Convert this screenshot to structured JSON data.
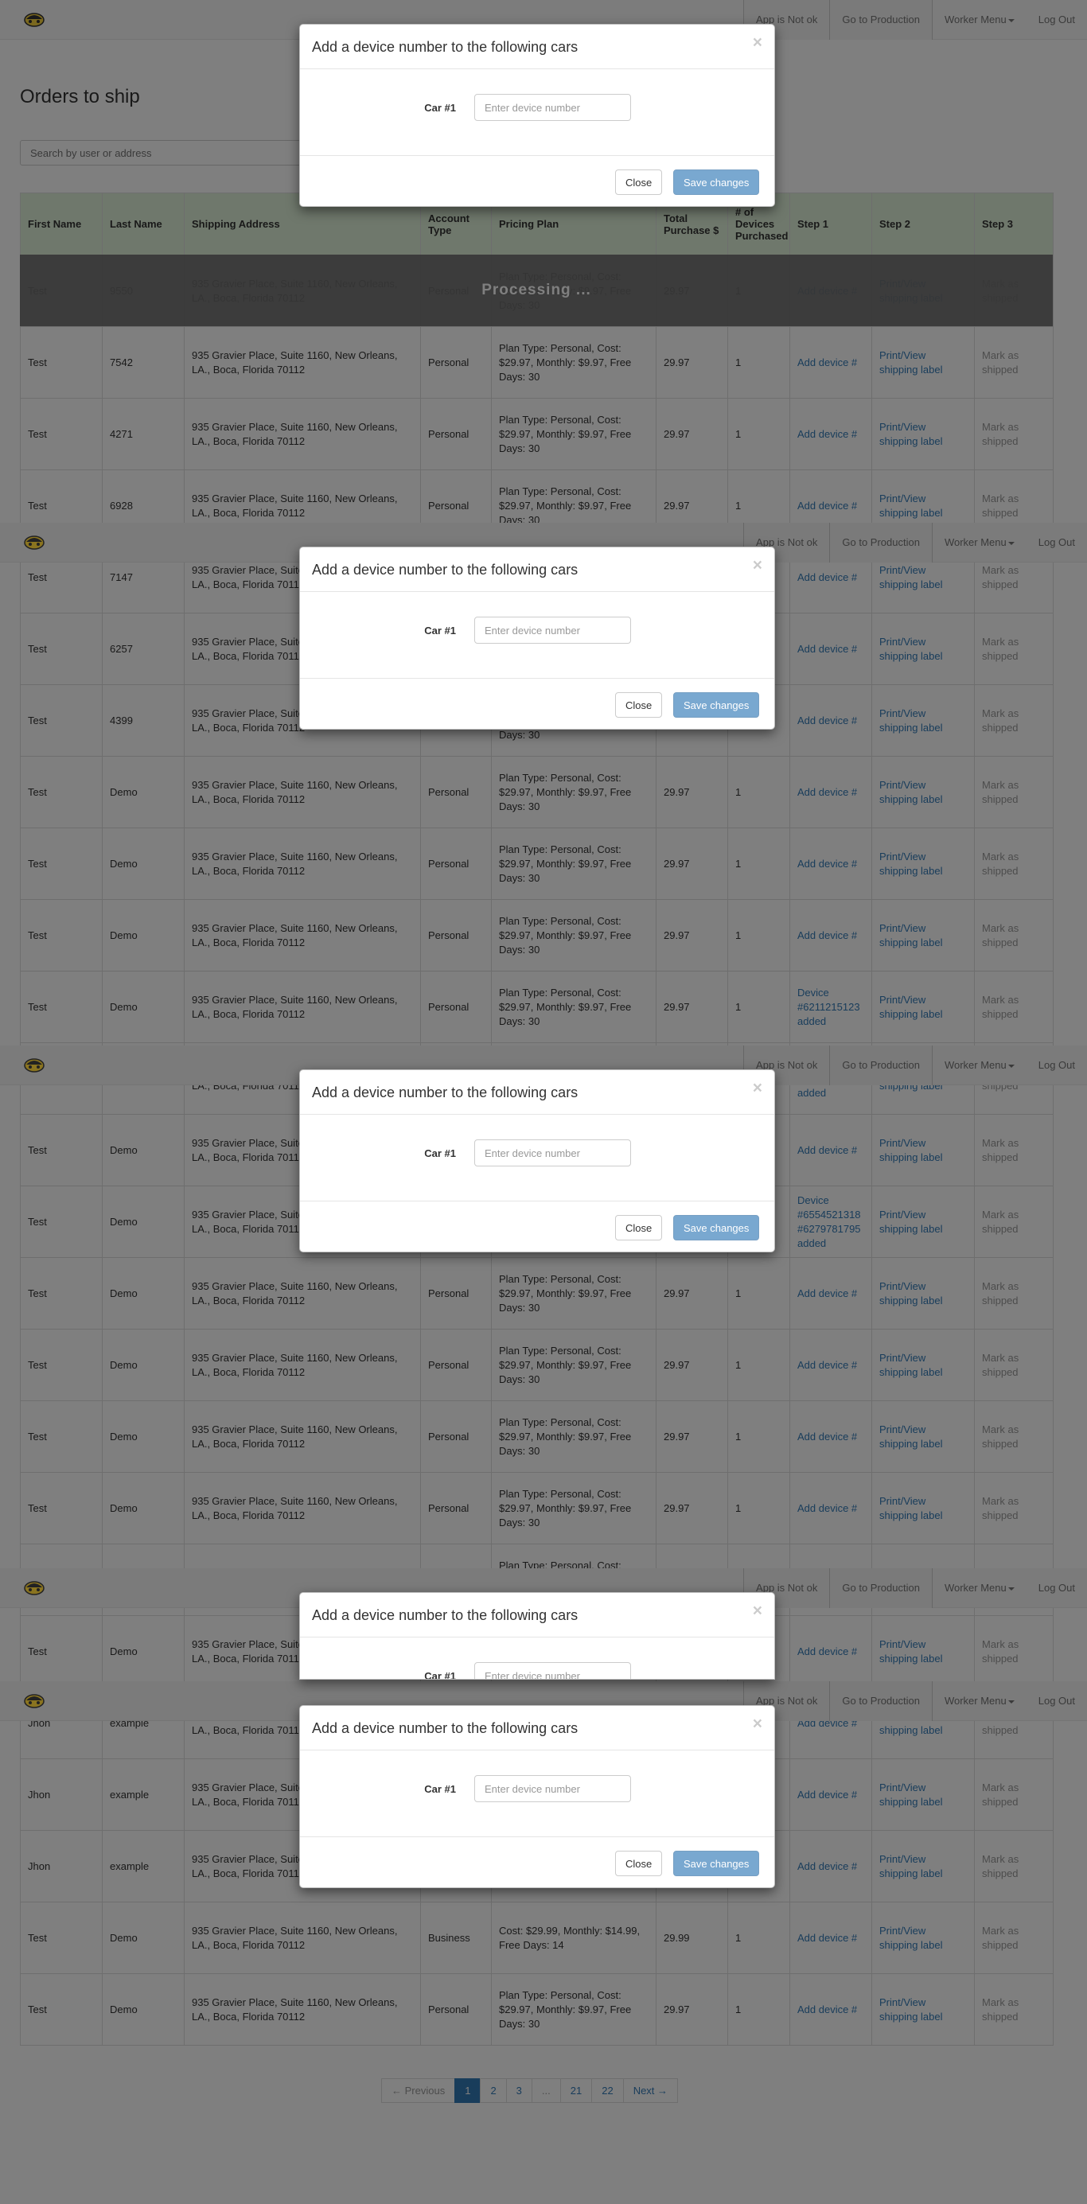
{
  "nav": {
    "app_status": "App is Not ok",
    "go_production": "Go to Production",
    "worker_menu": "Worker Menu",
    "log_out": "Log Out"
  },
  "page_title": "Orders to ship",
  "search": {
    "placeholder": "Search by user or address",
    "value": ""
  },
  "table": {
    "headers": [
      "First Name",
      "Last Name",
      "Shipping Address",
      "Account Type",
      "Pricing Plan",
      "Total Purchase $",
      "# of Devices Purchased",
      "Step 1",
      "Step 2",
      "Step 3"
    ],
    "rows": [
      {
        "first": "Test",
        "last": "9550",
        "address": "935 Gravier Place, Suite 1160, New Orleans, LA., Boca, Florida 70112",
        "account": "Personal",
        "plan": "Plan Type: Personal, Cost: $29.97, Monthly: $9.97, Free Days: 30",
        "total": "29.97",
        "devices": "1",
        "step1": "Add device #",
        "step2": "Print/View shipping label",
        "step3": "Mark as shipped"
      },
      {
        "first": "Test",
        "last": "7542",
        "address": "935 Gravier Place, Suite 1160, New Orleans, LA., Boca, Florida 70112",
        "account": "Personal",
        "plan": "Plan Type: Personal, Cost: $29.97, Monthly: $9.97, Free Days: 30",
        "total": "29.97",
        "devices": "1",
        "step1": "Add device #",
        "step2": "Print/View shipping label",
        "step3": "Mark as shipped"
      },
      {
        "first": "Test",
        "last": "4271",
        "address": "935 Gravier Place, Suite 1160, New Orleans, LA., Boca, Florida 70112",
        "account": "Personal",
        "plan": "Plan Type: Personal, Cost: $29.97, Monthly: $9.97, Free Days: 30",
        "total": "29.97",
        "devices": "1",
        "step1": "Add device #",
        "step2": "Print/View shipping label",
        "step3": "Mark as shipped"
      },
      {
        "first": "Test",
        "last": "6928",
        "address": "935 Gravier Place, Suite 1160, New Orleans, LA., Boca, Florida 70112",
        "account": "Personal",
        "plan": "Plan Type: Personal, Cost: $29.97, Monthly: $9.97, Free Days: 30",
        "total": "29.97",
        "devices": "1",
        "step1": "Add device #",
        "step2": "Print/View shipping label",
        "step3": "Mark as shipped"
      },
      {
        "first": "Test",
        "last": "7147",
        "address": "935 Gravier Place, Suite 1160, New Orleans, LA., Boca, Florida 70112",
        "account": "Personal",
        "plan": "Plan Type: Personal, Cost: $29.97, Monthly: $9.97, Free Days: 30",
        "total": "29.97",
        "devices": "1",
        "step1": "Add device #",
        "step2": "Print/View shipping label",
        "step3": "Mark as shipped"
      },
      {
        "first": "Test",
        "last": "6257",
        "address": "935 Gravier Place, Suite 1160, New Orleans, LA., Boca, Florida 70112",
        "account": "Personal",
        "plan": "Plan Type: Personal, Cost: $29.97, Monthly: $9.97, Free Days: 30",
        "total": "29.97",
        "devices": "1",
        "step1": "Add device #",
        "step2": "Print/View shipping label",
        "step3": "Mark as shipped"
      },
      {
        "first": "Test",
        "last": "4399",
        "address": "935 Gravier Place, Suite 1160, New Orleans, LA., Boca, Florida 70112",
        "account": "Personal",
        "plan": "Plan Type: Personal, Cost: $29.97, Monthly: $9.97, Free Days: 30",
        "total": "29.97",
        "devices": "1",
        "step1": "Add device #",
        "step2": "Print/View shipping label",
        "step3": "Mark as shipped"
      },
      {
        "first": "Test",
        "last": "Demo",
        "address": "935 Gravier Place, Suite 1160, New Orleans, LA., Boca, Florida 70112",
        "account": "Personal",
        "plan": "Plan Type: Personal, Cost: $29.97, Monthly: $9.97, Free Days: 30",
        "total": "29.97",
        "devices": "1",
        "step1": "Add device #",
        "step2": "Print/View shipping label",
        "step3": "Mark as shipped"
      },
      {
        "first": "Test",
        "last": "Demo",
        "address": "935 Gravier Place, Suite 1160, New Orleans, LA., Boca, Florida 70112",
        "account": "Personal",
        "plan": "Plan Type: Personal, Cost: $29.97, Monthly: $9.97, Free Days: 30",
        "total": "29.97",
        "devices": "1",
        "step1": "Add device #",
        "step2": "Print/View shipping label",
        "step3": "Mark as shipped"
      },
      {
        "first": "Test",
        "last": "Demo",
        "address": "935 Gravier Place, Suite 1160, New Orleans, LA., Boca, Florida 70112",
        "account": "Personal",
        "plan": "Plan Type: Personal, Cost: $29.97, Monthly: $9.97, Free Days: 30",
        "total": "29.97",
        "devices": "1",
        "step1": "Add device #",
        "step2": "Print/View shipping label",
        "step3": "Mark as shipped"
      },
      {
        "first": "Test",
        "last": "Demo",
        "address": "935 Gravier Place, Suite 1160, New Orleans, LA., Boca, Florida 70112",
        "account": "Personal",
        "plan": "Plan Type: Personal, Cost: $29.97, Monthly: $9.97, Free Days: 30",
        "total": "29.97",
        "devices": "1",
        "step1": "Device #6211215123 added",
        "step2": "Print/View shipping label",
        "step3": "Mark as shipped"
      },
      {
        "first": "Test",
        "last": "Demo",
        "address": "935 Gravier Place, Suite 1160, New Orleans, LA., Boca, Florida 70112",
        "account": "Personal",
        "plan": "Plan Type: Personal, Cost: $29.97, Monthly: $9.97, Free Days: 30",
        "total": "29.97",
        "devices": "1",
        "step1": "Device #6211215123 added",
        "step2": "Print/View shipping label",
        "step3": "Mark as shipped"
      },
      {
        "first": "Test",
        "last": "Demo",
        "address": "935 Gravier Place, Suite 1160, New Orleans, LA., Boca, Florida 70112",
        "account": "Personal",
        "plan": "Plan Type: Personal, Cost: $29.97, Monthly: $9.97, Free Days: 30",
        "total": "29.97",
        "devices": "1",
        "step1": "Add device #",
        "step2": "Print/View shipping label",
        "step3": "Mark as shipped"
      },
      {
        "first": "Test",
        "last": "Demo",
        "address": "935 Gravier Place, Suite 1160, New Orleans, LA., Boca, Florida 70112",
        "account": "Personal",
        "plan": "Plan Type: Personal, Cost: $29.97, Monthly: $9.97, Free Days: 30",
        "total": "29.97",
        "devices": "2",
        "step1": "Device #6554521318 #6279781795 added",
        "step2": "Print/View shipping label",
        "step3": "Mark as shipped"
      },
      {
        "first": "Test",
        "last": "Demo",
        "address": "935 Gravier Place, Suite 1160, New Orleans, LA., Boca, Florida 70112",
        "account": "Personal",
        "plan": "Plan Type: Personal, Cost: $29.97, Monthly: $9.97, Free Days: 30",
        "total": "29.97",
        "devices": "1",
        "step1": "Add device #",
        "step2": "Print/View shipping label",
        "step3": "Mark as shipped"
      },
      {
        "first": "Test",
        "last": "Demo",
        "address": "935 Gravier Place, Suite 1160, New Orleans, LA., Boca, Florida 70112",
        "account": "Personal",
        "plan": "Plan Type: Personal, Cost: $29.97, Monthly: $9.97, Free Days: 30",
        "total": "29.97",
        "devices": "1",
        "step1": "Add device #",
        "step2": "Print/View shipping label",
        "step3": "Mark as shipped"
      },
      {
        "first": "Test",
        "last": "Demo",
        "address": "935 Gravier Place, Suite 1160, New Orleans, LA., Boca, Florida 70112",
        "account": "Personal",
        "plan": "Plan Type: Personal, Cost: $29.97, Monthly: $9.97, Free Days: 30",
        "total": "29.97",
        "devices": "1",
        "step1": "Add device #",
        "step2": "Print/View shipping label",
        "step3": "Mark as shipped"
      },
      {
        "first": "Test",
        "last": "Demo",
        "address": "935 Gravier Place, Suite 1160, New Orleans, LA., Boca, Florida 70112",
        "account": "Personal",
        "plan": "Plan Type: Personal, Cost: $29.97, Monthly: $9.97, Free Days: 30",
        "total": "29.97",
        "devices": "1",
        "step1": "Add device #",
        "step2": "Print/View shipping label",
        "step3": "Mark as shipped"
      },
      {
        "first": "Test",
        "last": "Demo",
        "address": "935 Gravier Place, Suite 1160, New Orleans, LA., Boca, Florida 70112",
        "account": "Personal",
        "plan": "Plan Type: Personal, Cost: $29.97, Monthly: $9.97, Free Days: 30",
        "total": "29.97",
        "devices": "1",
        "step1": "Add device #",
        "step2": "Print/View shipping label",
        "step3": "Mark as shipped"
      },
      {
        "first": "Test",
        "last": "Demo",
        "address": "935 Gravier Place, Suite 1160, New Orleans, LA., Boca, Florida 70112",
        "account": "Personal",
        "plan": "Plan Type: Personal, Cost: $29.97, Monthly: $9.97, Free Days: 30",
        "total": "29.97",
        "devices": "1",
        "step1": "Add device #",
        "step2": "Print/View shipping label",
        "step3": "Mark as shipped"
      },
      {
        "first": "Jhon",
        "last": "example",
        "address": "935 Gravier Place, Suite 1160, New Orleans, LA., Boca, Florida 70112",
        "account": "Personal",
        "plan": "Plan Type: Personal, Cost: $29.97, Monthly: $9.97, Free Days: 30",
        "total": "29.97",
        "devices": "1",
        "step1": "Add device #",
        "step2": "Print/View shipping label",
        "step3": "Mark as shipped"
      },
      {
        "first": "Jhon",
        "last": "example",
        "address": "935 Gravier Place, Suite 1160, New Orleans, LA., Boca, Florida 70112",
        "account": "Personal",
        "plan": "Plan Type: Personal, Cost: $29.97, Monthly: $9.97, Free Days: 30",
        "total": "29.97",
        "devices": "1",
        "step1": "Add device #",
        "step2": "Print/View shipping label",
        "step3": "Mark as shipped"
      },
      {
        "first": "Jhon",
        "last": "example",
        "address": "935 Gravier Place, Suite 1160, New Orleans, LA., Boca, Florida 70112",
        "account": "Personal",
        "plan": "Plan Type: Personal, Cost: $29.97, Monthly: $9.97, Free Days: 30",
        "total": "29.97",
        "devices": "1",
        "step1": "Add device #",
        "step2": "Print/View shipping label",
        "step3": "Mark as shipped"
      },
      {
        "first": "Test",
        "last": "Demo",
        "address": "935 Gravier Place, Suite 1160, New Orleans, LA., Boca, Florida 70112",
        "account": "Business",
        "plan": "Cost: $29.99, Monthly: $14.99, Free Days: 14",
        "total": "29.99",
        "devices": "1",
        "step1": "Add device #",
        "step2": "Print/View shipping label",
        "step3": "Mark as shipped"
      },
      {
        "first": "Test",
        "last": "Demo",
        "address": "935 Gravier Place, Suite 1160, New Orleans, LA., Boca, Florida 70112",
        "account": "Personal",
        "plan": "Plan Type: Personal, Cost: $29.97, Monthly: $9.97, Free Days: 30",
        "total": "29.97",
        "devices": "1",
        "step1": "Add device #",
        "step2": "Print/View shipping label",
        "step3": "Mark as shipped"
      }
    ]
  },
  "processing_text": "Processing ...",
  "pagination": [
    "← Previous",
    "1",
    "2",
    "3",
    "...",
    "21",
    "22",
    "Next →"
  ],
  "modal": {
    "title": "Add a device number to the following cars",
    "close_x": "×",
    "car_label": "Car #1",
    "input_placeholder": "Enter device number",
    "close_button": "Close",
    "save_button": "Save changes"
  },
  "colors": {
    "header_green": "#dff0d8",
    "link_blue": "#337ab7",
    "logo_yellow": "#f4d03f"
  }
}
